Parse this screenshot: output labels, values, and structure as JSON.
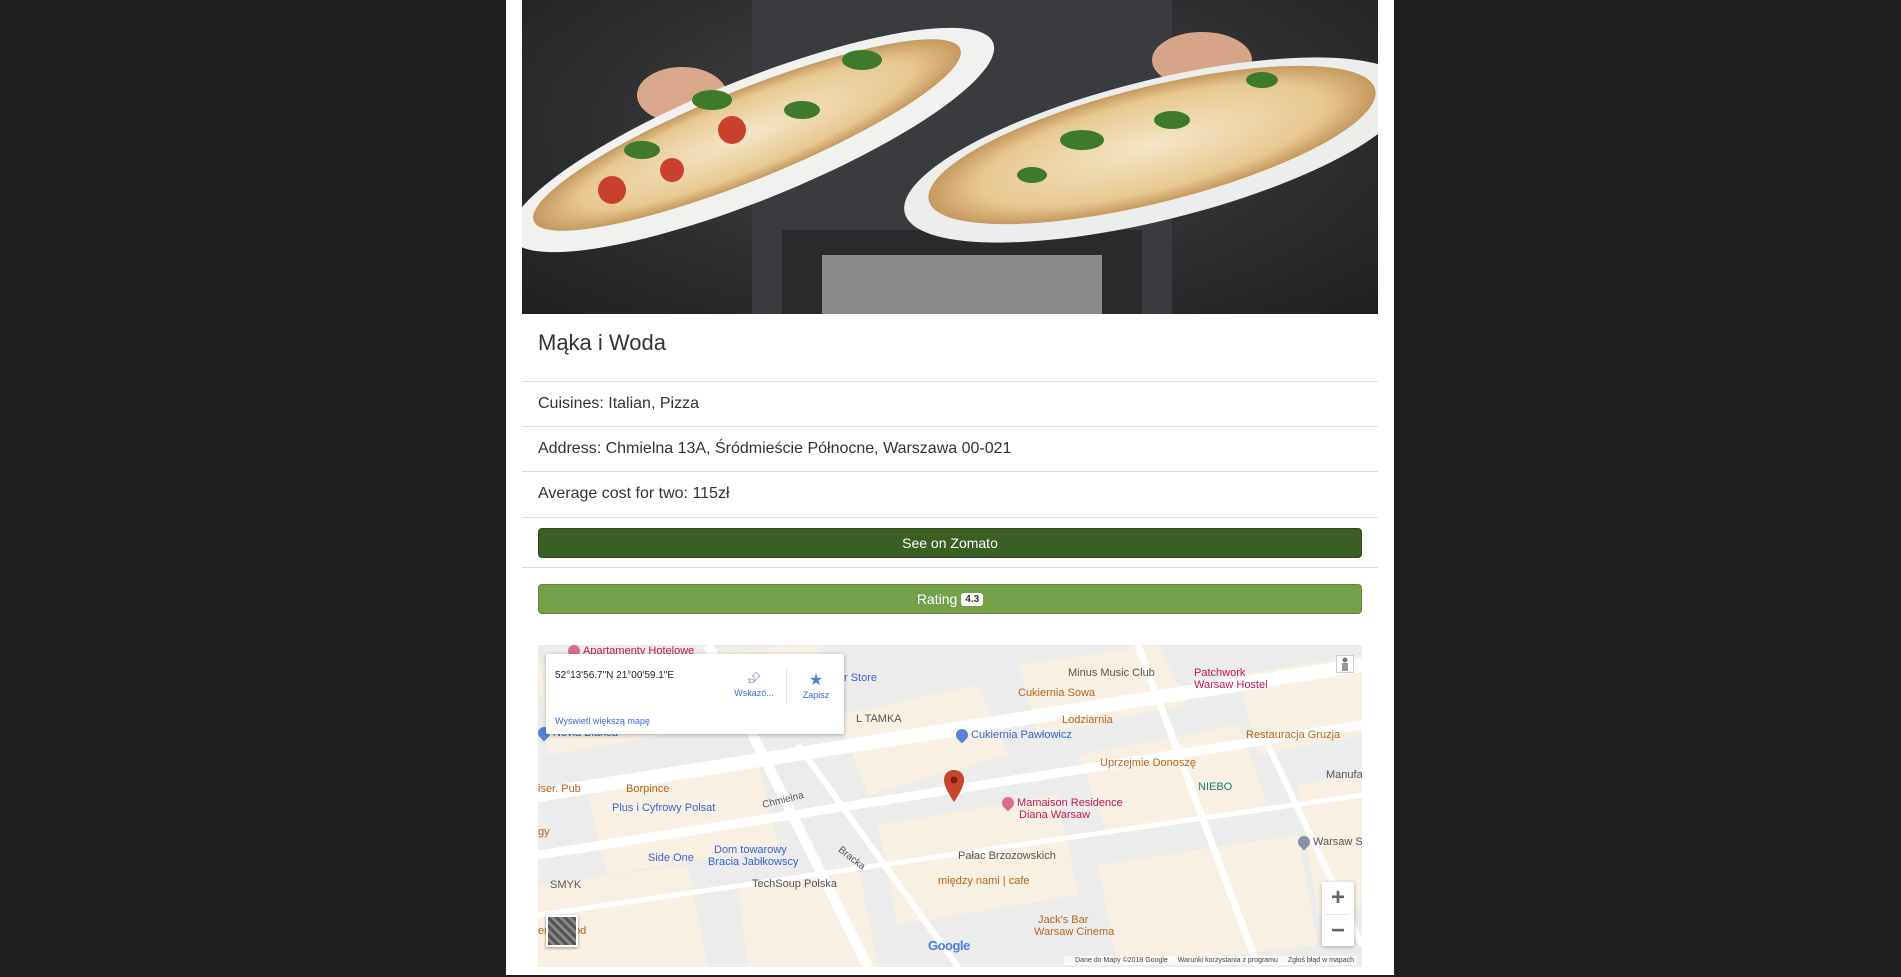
{
  "restaurant": {
    "name": "Mąka i Woda",
    "cuisines": "Cuisines: Italian, Pizza",
    "address": "Address: Chmielna 13A, Śródmieście Północne, Warszawa 00-021",
    "average_cost": "Average cost for two: 115zł"
  },
  "buttons": {
    "zomato_label": "See on Zomato",
    "rating_label": "Rating",
    "rating_value": "4.3"
  },
  "colors": {
    "zomato_button": "#3b5f23",
    "rating_button": "#74a04a",
    "page_background": "#1f1d1e"
  },
  "map": {
    "infobox": {
      "coordinates": "52°13'56.7\"N 21°00'59.1\"E",
      "directions_label": "Wskazó...",
      "save_label": "Zapisz",
      "bigger_map_link": "Wyświetl większą mapę"
    },
    "places": {
      "apartamenty": "Apartamenty Hotelowe",
      "store": "r Store",
      "minus_music": "Minus Music Club",
      "patchwork_1": "Patchwork",
      "patchwork_2": "Warsaw Hostel",
      "sowa": "Cukiernia Sowa",
      "tamka": "L TAMKA",
      "lodziarnia": "Lodziarnia",
      "pawlowicz": "Cukiernia Pawłowicz",
      "gruzja": "Restauracja Gruzja",
      "novia": "Novia Blanca",
      "uprzejmie": "Uprzejmie Donoszę",
      "manufa": "Manufa",
      "borpince": "Borpince",
      "niebo": "NIEBO",
      "iser_pub": "iser. Pub",
      "plus": "Plus i Cyfrowy Polsat",
      "chmielna": "Chmielna",
      "mamaison_1": "Mamaison Residence",
      "mamaison_2": "Diana Warsaw",
      "gy": "gy",
      "warsaw_sals": "Warsaw Sals",
      "dom_1": "Dom towarowy",
      "dom_2": "Bracia Jabłkowscy",
      "side_one": "Side One",
      "palac": "Pałac Brzozowskich",
      "bracka": "Bracka",
      "smyk": "SMYK",
      "techsoup": "TechSoup Polska",
      "miedzy": "między nami | cafe",
      "food": "er & Food",
      "jacks_1": "Jack's Bar",
      "jacks_2": "Warsaw Cinema"
    },
    "zoom_in": "+",
    "zoom_out": "−",
    "logo": "Google",
    "footer": {
      "data": "Dane do Mapy ©2018 Google",
      "terms": "Warunki korzystania z programu",
      "report": "Zgłoś błąd w mapach"
    }
  }
}
